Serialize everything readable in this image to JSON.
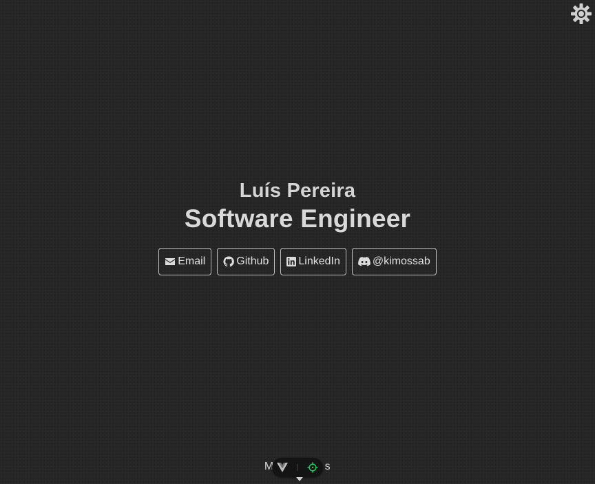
{
  "profile": {
    "name": "Luís Pereira",
    "role": "Software Engineer"
  },
  "links": [
    {
      "label": "Email",
      "icon": "envelope-icon"
    },
    {
      "label": "Github",
      "icon": "github-icon"
    },
    {
      "label": "LinkedIn",
      "icon": "linkedin-icon"
    },
    {
      "label": "@kimossab",
      "icon": "discord-icon"
    }
  ],
  "footer": {
    "section_label_left": "M",
    "section_label_right": "s"
  },
  "theme": {
    "toggle_icon": "sun-gear-icon"
  },
  "colors": {
    "background": "#262626",
    "text": "#dcdcdc",
    "button_border": "#bfbfbf",
    "devtools_accent": "#22c55e"
  }
}
